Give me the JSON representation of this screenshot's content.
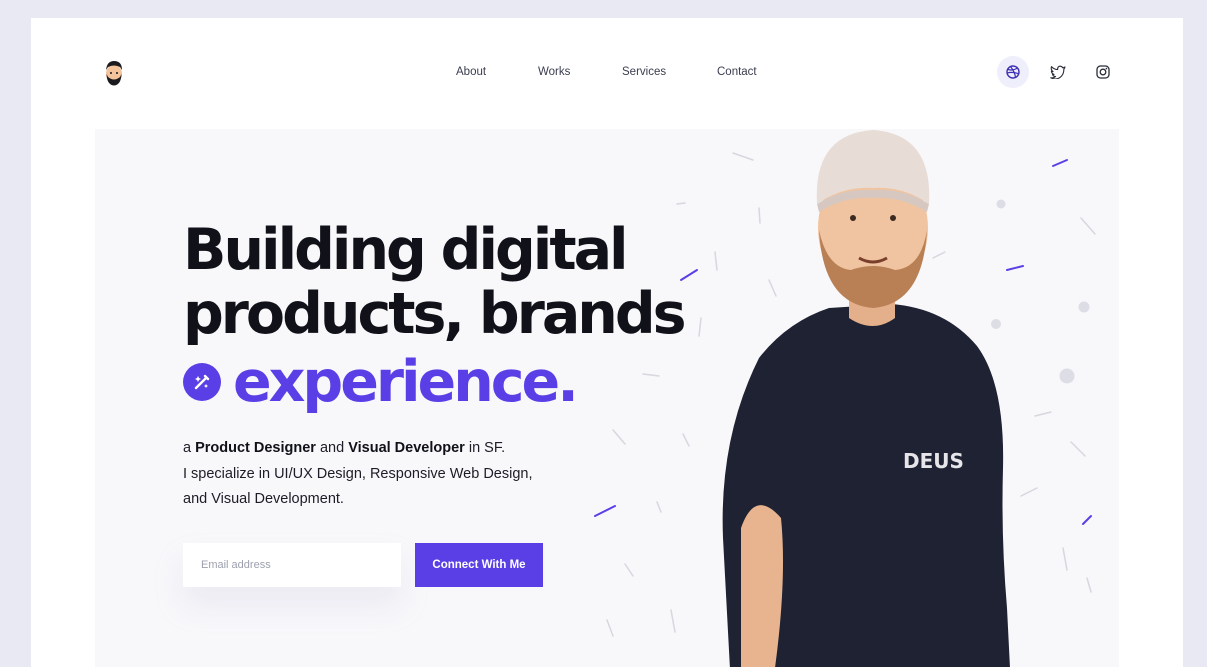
{
  "header": {
    "logo": "avatar-logo",
    "nav": [
      {
        "label": "About"
      },
      {
        "label": "Works"
      },
      {
        "label": "Services"
      },
      {
        "label": "Contact"
      }
    ],
    "social": [
      {
        "icon": "dribbble-icon"
      },
      {
        "icon": "twitter-icon"
      },
      {
        "icon": "instagram-icon"
      }
    ]
  },
  "hero": {
    "headline_line1": "Building digital",
    "headline_line2": "products, brands",
    "accent_word": "experience.",
    "intro": {
      "a": "a ",
      "role1": "Product Designer",
      "and": " and ",
      "role2": "Visual Developer",
      "in": " in SF.",
      "line2": "I specialize in UI/UX Design, Responsive Web Design,",
      "line3": "and Visual Development."
    },
    "email_placeholder": "Email address",
    "cta_label": "Connect With Me",
    "shirt_text": "DEUS"
  },
  "colors": {
    "accent": "#5b3fe6",
    "page_bg": "#e9e9f3",
    "panel_bg": "#f8f8fb",
    "heading": "#111219"
  }
}
